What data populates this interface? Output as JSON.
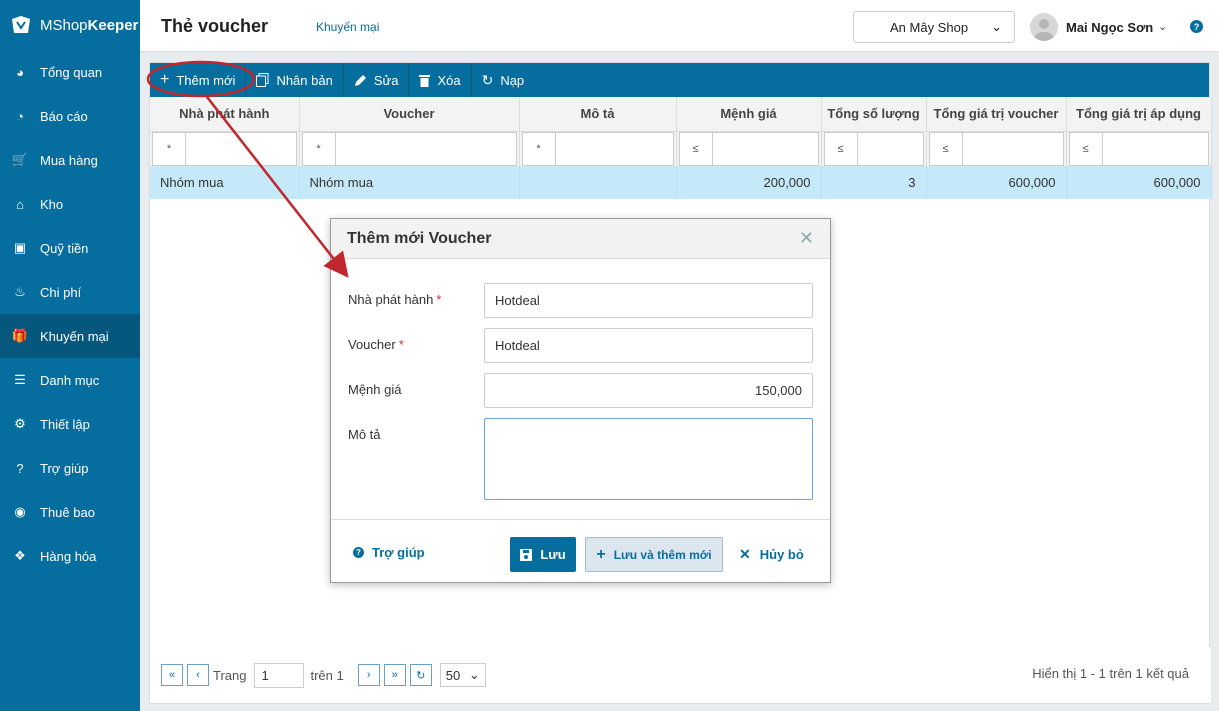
{
  "app": {
    "logo_light": "MShop",
    "logo_bold": "Keeper"
  },
  "sidebar": {
    "items": [
      {
        "label": "Tổng quan",
        "icon": "dashboard-icon"
      },
      {
        "label": "Báo cáo",
        "icon": "pie-chart-icon"
      },
      {
        "label": "Mua hàng",
        "icon": "cart-icon"
      },
      {
        "label": "Kho",
        "icon": "warehouse-icon"
      },
      {
        "label": "Quỹ tiền",
        "icon": "safe-icon"
      },
      {
        "label": "Chi phí",
        "icon": "money-bag-icon"
      },
      {
        "label": "Khuyến mại",
        "icon": "gift-icon",
        "active": true
      },
      {
        "label": "Danh mục",
        "icon": "list-icon"
      },
      {
        "label": "Thiết lập",
        "icon": "gear-icon"
      },
      {
        "label": "Trợ giúp",
        "icon": "help-icon"
      },
      {
        "label": "Thuê bao",
        "icon": "user-icon"
      },
      {
        "label": "Hàng hóa",
        "icon": "cubes-icon"
      }
    ]
  },
  "header": {
    "title": "Thẻ voucher",
    "breadcrumb": "Khuyến mại",
    "shop": "An Mây Shop",
    "user": "Mai Ngọc Sơn"
  },
  "toolbar": {
    "add": "Thêm mới",
    "duplicate": "Nhân bản",
    "edit": "Sửa",
    "delete": "Xóa",
    "reload": "Nạp"
  },
  "table": {
    "columns": [
      "Nhà phát hành",
      "Voucher",
      "Mô tả",
      "Mệnh giá",
      "Tổng số lượng",
      "Tổng giá trị voucher",
      "Tổng giá trị áp dụng"
    ],
    "filter_ops": [
      "*",
      "*",
      "*",
      "≤",
      "≤",
      "≤",
      "≤"
    ],
    "rows": [
      {
        "issuer": "Nhóm mua",
        "voucher": "Nhóm mua",
        "description": "",
        "face_value": "200,000",
        "quantity": "3",
        "total_voucher": "600,000",
        "total_applied": "600,000"
      }
    ]
  },
  "pager": {
    "page_label": "Trang",
    "page_value": "1",
    "of_label": "trên 1",
    "page_size": "50",
    "summary": "Hiển thị 1 - 1 trên 1 kết quả"
  },
  "dialog": {
    "title": "Thêm mới Voucher",
    "fields": {
      "issuer_label": "Nhà phát hành",
      "issuer_value": "Hotdeal",
      "voucher_label": "Voucher",
      "voucher_value": "Hotdeal",
      "face_value_label": "Mệnh giá",
      "face_value_value": "150,000",
      "description_label": "Mô tả",
      "required_mark": "*"
    },
    "help": "Trợ giúp",
    "save": "Lưu",
    "save_add": "Lưu và thêm mới",
    "cancel": "Hủy bỏ"
  },
  "colors": {
    "brand": "#066e9f",
    "annotation": "#c0282d",
    "row_highlight": "#c6e9f9"
  }
}
